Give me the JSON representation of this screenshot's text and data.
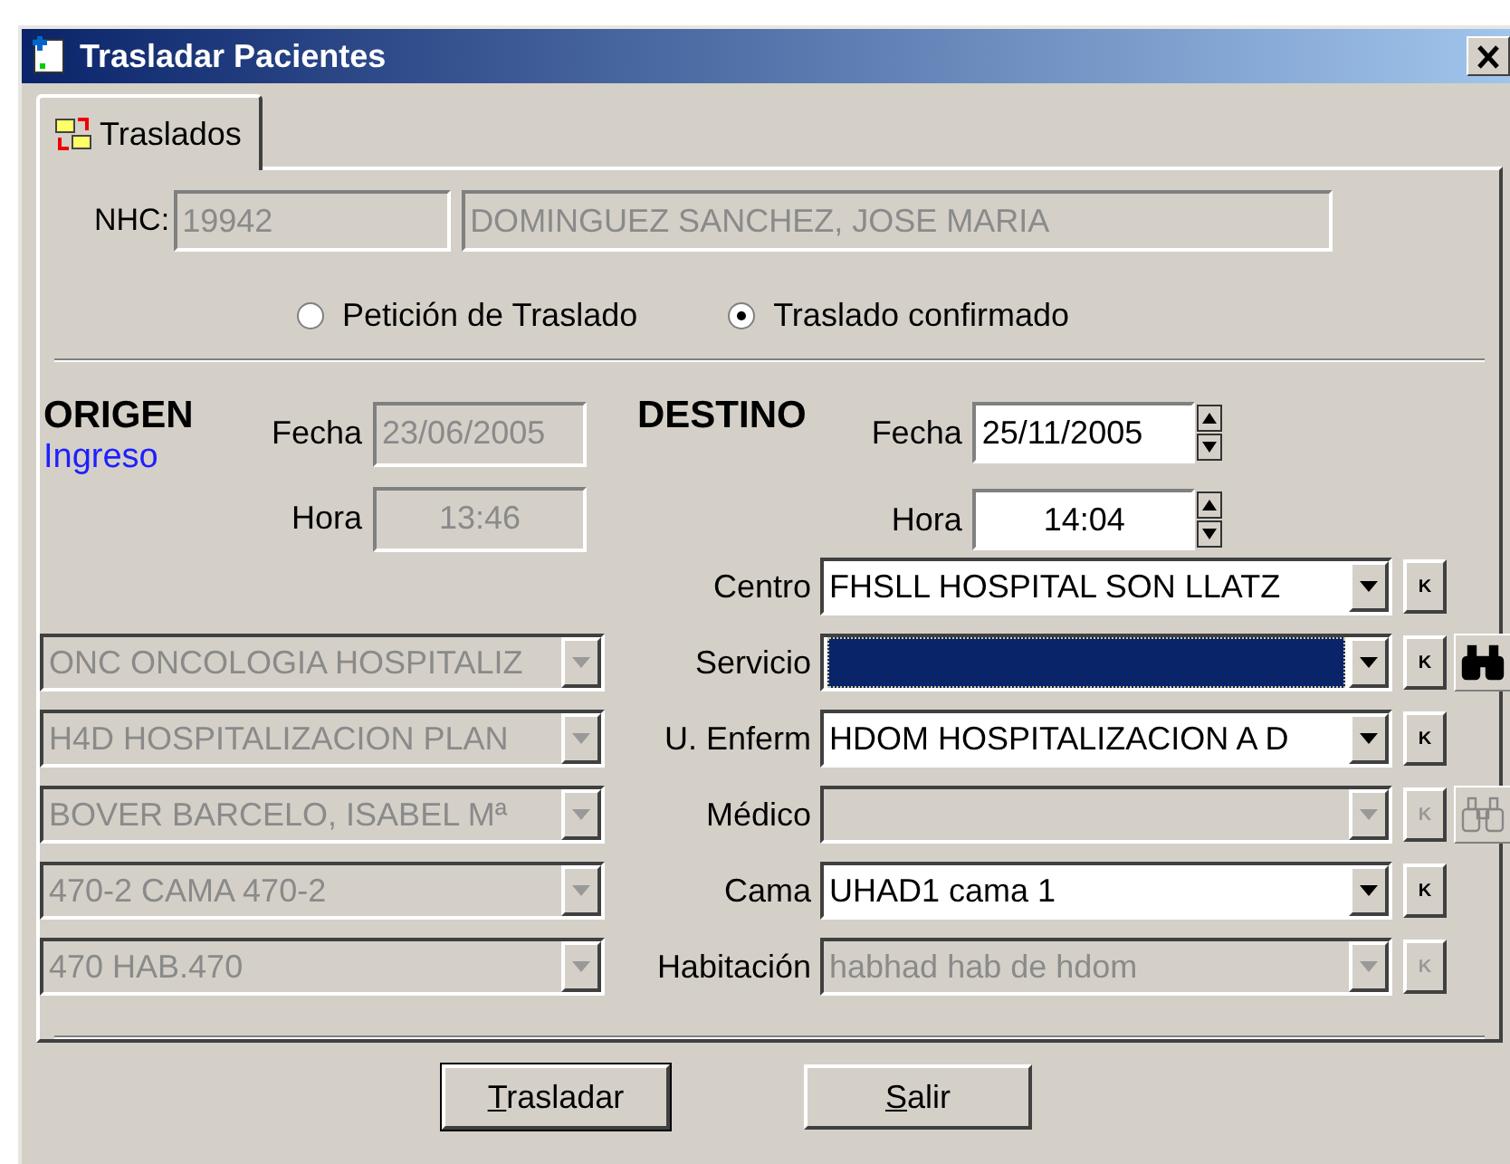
{
  "window": {
    "title": "Trasladar Pacientes"
  },
  "tabs": [
    {
      "label": "Traslados",
      "selected": true
    }
  ],
  "patient": {
    "nhc_label": "NHC:",
    "nhc": "19942",
    "name": "DOMINGUEZ SANCHEZ, JOSE MARIA"
  },
  "radios": [
    {
      "label": "Petición de Traslado",
      "selected": false
    },
    {
      "label": "Traslado confirmado",
      "selected": true
    }
  ],
  "origen": {
    "title": "ORIGEN",
    "subtitle": "Ingreso",
    "fecha_label": "Fecha",
    "fecha": "23/06/2005",
    "hora_label": "Hora",
    "hora": "13:46",
    "fields": [
      {
        "value": "ONC ONCOLOGIA HOSPITALIZ",
        "disabled": true
      },
      {
        "value": "H4D HOSPITALIZACION PLAN",
        "disabled": true
      },
      {
        "value": "BOVER BARCELO, ISABEL Mª",
        "disabled": true
      },
      {
        "value": "470-2 CAMA 470-2",
        "disabled": true
      },
      {
        "value": "470 HAB.470",
        "disabled": true
      }
    ]
  },
  "destino": {
    "title": "DESTINO",
    "fecha_label": "Fecha",
    "fecha": "25/11/2005",
    "hora_label": "Hora",
    "hora": "14:04",
    "fields": [
      {
        "label": "Centro",
        "value": "FHSLL HOSPITAL SON LLATZ",
        "disabled": false,
        "focused": false,
        "key": "K",
        "search": false
      },
      {
        "label": "Servicio",
        "disabled": false,
        "focused": true,
        "key": "K",
        "search": true
      },
      {
        "label": "U. Enferm",
        "value": "HDOM HOSPITALIZACION A D",
        "disabled": false,
        "focused": false,
        "key": "K",
        "search": false
      },
      {
        "label": "Médico",
        "disabled": true,
        "focused": false,
        "key": "K",
        "search": true
      },
      {
        "label": "Cama",
        "value": "UHAD1 cama 1",
        "disabled": false,
        "focused": false,
        "key": "K",
        "search": false
      },
      {
        "label": "Habitación",
        "value": "habhad hab de hdom",
        "disabled": true,
        "focused": false,
        "key": "K",
        "search": false
      }
    ]
  },
  "buttons": [
    {
      "label": "Trasladar"
    },
    {
      "label": "Salir"
    }
  ]
}
